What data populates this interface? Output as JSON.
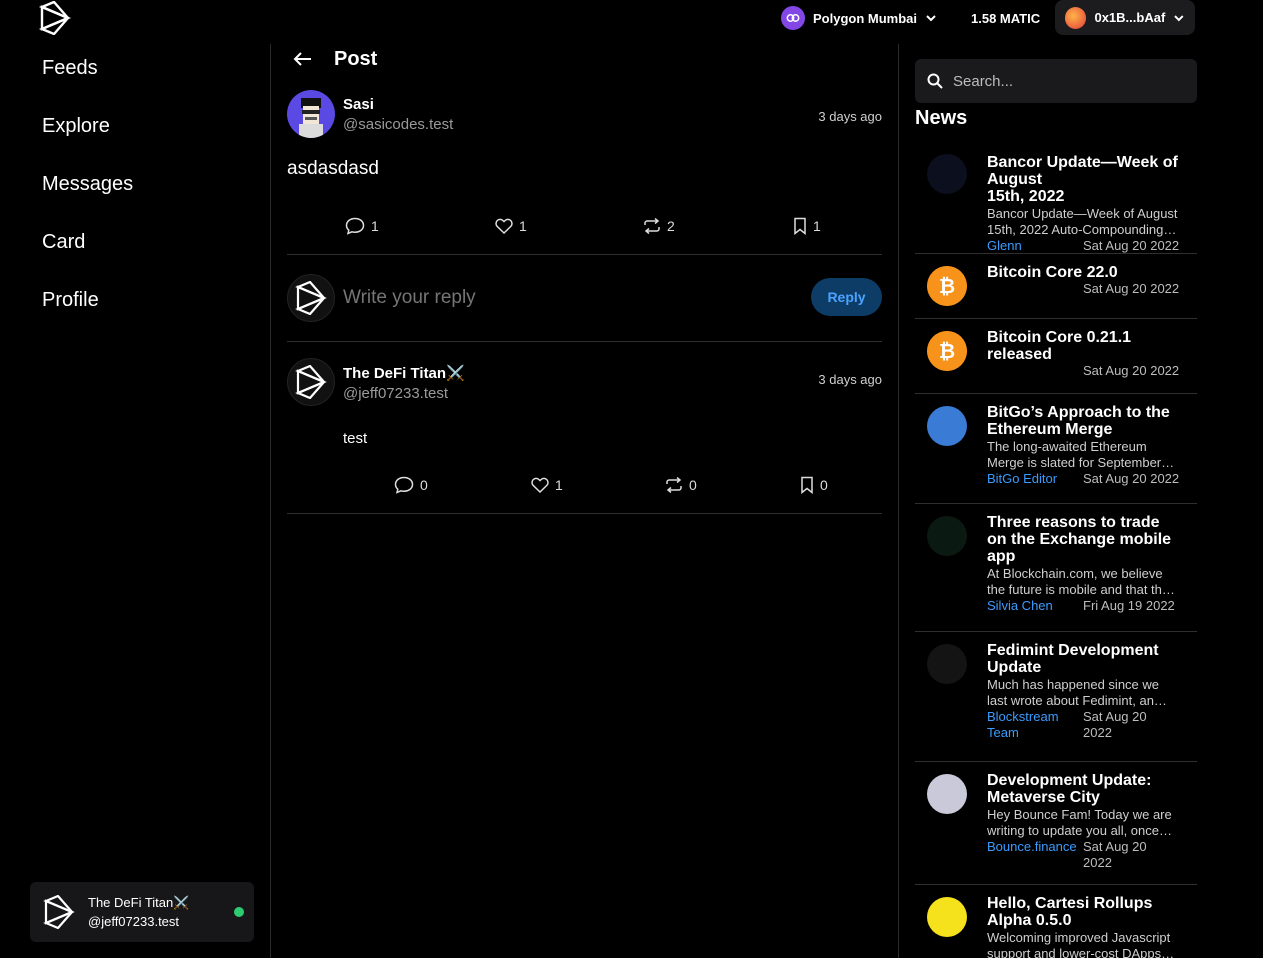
{
  "topbar": {
    "network": "Polygon Mumbai",
    "balance": "1.58 MATIC",
    "account": "0x1B...bAaf"
  },
  "nav": {
    "items": [
      "Feeds",
      "Explore",
      "Messages",
      "Card",
      "Profile"
    ]
  },
  "current_user": {
    "name": "The DeFi Titan⚔️",
    "handle": "@jeff07233.test"
  },
  "post_view": {
    "title": "Post",
    "post": {
      "author": "Sasi",
      "handle": "@sasicodes.test",
      "time": "3 days ago",
      "text": "asdasdasd",
      "comments": "1",
      "likes": "1",
      "mirrors": "2",
      "bookmarks": "1"
    },
    "reply_placeholder": "Write your reply",
    "reply_button": "Reply",
    "reply": {
      "author": "The DeFi Titan⚔️",
      "handle": "@jeff07233.test",
      "time": "3 days ago",
      "text": "test",
      "comments": "0",
      "likes": "1",
      "mirrors": "0",
      "bookmarks": "0"
    }
  },
  "sidebar": {
    "search_placeholder": "Search...",
    "news_title": "News",
    "news": [
      {
        "title": "Bancor Update—Week of August\n15th, 2022",
        "desc": "Bancor Update—Week of August\n15th, 2022 Auto-Compounding…",
        "author": "Glenn",
        "date": "Sat Aug 20 2022",
        "thumb_color": "#0b0f1e"
      },
      {
        "title": "Bitcoin Core 22.0",
        "desc": "",
        "author": "",
        "date": "Sat Aug 20 2022",
        "thumb_color": "#f7931a"
      },
      {
        "title": "Bitcoin Core 0.21.1\nreleased",
        "desc": "",
        "author": "",
        "date": "Sat Aug 20 2022",
        "thumb_color": "#f7931a"
      },
      {
        "title": "BitGo’s Approach to the\nEthereum Merge",
        "desc": "The long-awaited Ethereum\nMerge is slated for September…",
        "author": "BitGo Editor",
        "date": "Sat Aug 20 2022",
        "thumb_color": "#3a7bd5"
      },
      {
        "title": "Three reasons to trade\non the Exchange mobile\napp",
        "desc": "At Blockchain.com, we believe\nthe future is mobile and that th…",
        "author": "Silvia Chen",
        "date": "Fri Aug 19 2022",
        "thumb_color": "#0a1a12"
      },
      {
        "title": "Fedimint Development\nUpdate",
        "desc": "Much has happened since we\nlast wrote about Fedimint, an…",
        "author": "Blockstream\nTeam",
        "date": "Sat Aug 20\n2022",
        "thumb_color": "#141414"
      },
      {
        "title": "Development Update:\nMetaverse City",
        "desc": "Hey Bounce Fam! Today we are\nwriting to update you all, once…",
        "author": "Bounce.finance",
        "date": "Sat Aug 20\n2022",
        "thumb_color": "#c9c9d9"
      },
      {
        "title": "Hello, Cartesi Rollups\nAlpha 0.5.0",
        "desc": "Welcoming improved Javascript\nsupport and lower-cost DApps…",
        "author": "",
        "date": "",
        "thumb_color": "#f5e11c"
      }
    ]
  }
}
